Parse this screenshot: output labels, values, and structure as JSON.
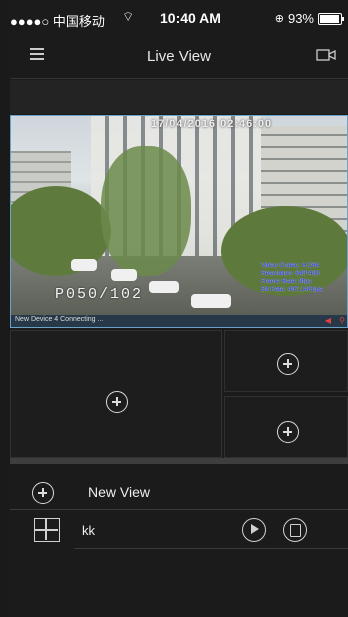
{
  "status_bar": {
    "carrier": "●●●●○ 中国移动 ",
    "wifi_icon": "wifi-icon",
    "time": "10:40 AM",
    "battery_percent": "93%",
    "battery_level": 0.93
  },
  "nav": {
    "menu_icon": "hamburger-menu-icon",
    "title": "Live View",
    "camera_icon": "camera-icon"
  },
  "live_view": {
    "timestamp": "17/04/2016 02:46:00",
    "camera_label": "P050/102",
    "osd_info": [
      "Video Codec: H.264",
      "Resolution: 640*480",
      "Frame Rate: 8fps",
      "Bit Rate: 497.14Kbps"
    ],
    "device_status": "New Device 4  Connecting ..."
  },
  "actions": {
    "new_view_label": "New View",
    "view_items": [
      {
        "label": "kk"
      }
    ]
  }
}
